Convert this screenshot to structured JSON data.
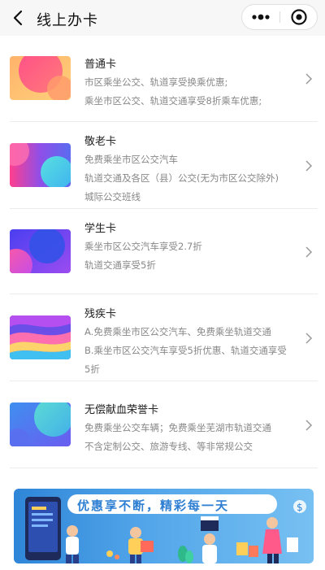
{
  "header": {
    "title": "线上办卡"
  },
  "cards": [
    {
      "title": "普通卡",
      "lines": [
        "市区乘坐公交、轨道享受换乘优惠;",
        "乘坐市区公交、轨道交通享受8折乘车优惠;"
      ]
    },
    {
      "title": "敬老卡",
      "lines": [
        "免费乘坐市区公交汽车",
        "轨道交通及各区（县）公交(无为市区公交除外)",
        "城际公交班线"
      ]
    },
    {
      "title": "学生卡",
      "lines": [
        "乘坐市区公交汽车享受2.7折",
        "轨道交通享受5折"
      ]
    },
    {
      "title": "残疾卡",
      "lines": [
        "A.免费乘坐市区公交汽车、免费乘坐轨道交通",
        "B.乘坐市区公交汽车享受5折优惠、轨道交通享受",
        "5折"
      ]
    },
    {
      "title": "无偿献血荣誉卡",
      "lines": [
        "免费乘坐公交车辆；免费乘坐芜湖市轨道交通",
        "不含定制公交、旅游专线、等非常规公交"
      ]
    }
  ],
  "banner": {
    "text": "优惠享不断，精彩每一天"
  },
  "colors": {
    "text_primary": "#222222",
    "text_secondary": "#888888",
    "banner_blue": "#2f86d8"
  },
  "icons": [
    "back-arrow-icon",
    "more-dots-icon",
    "close-target-icon",
    "chevron-right-icon"
  ]
}
